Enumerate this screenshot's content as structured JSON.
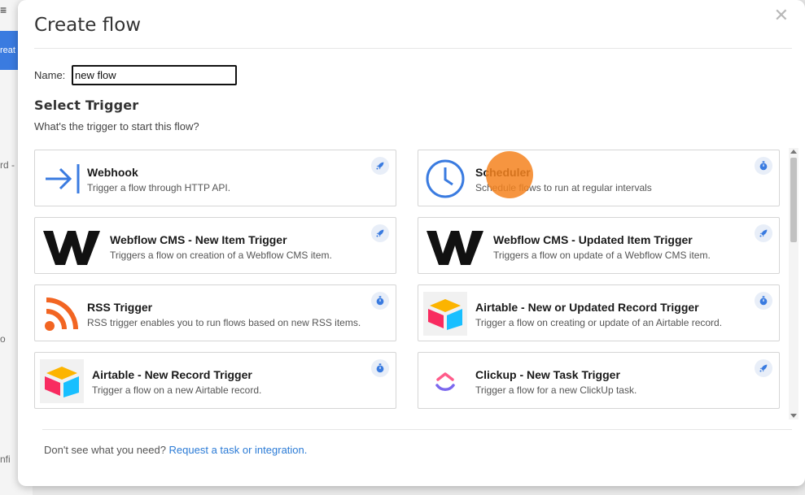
{
  "background": {
    "menu_glyph": "≡",
    "button_fragment": "reat",
    "text_fragment_1": "rd -",
    "text_fragment_2": "o",
    "text_fragment_3": "nfi"
  },
  "modal": {
    "title": "Create flow",
    "close_glyph": "✕",
    "name_label": "Name:",
    "name_value": "new flow",
    "section_title": "Select Trigger",
    "section_subtitle": "What's the trigger to start this flow?",
    "footer_text": "Don't see what you need?",
    "footer_link": "Request a task or integration."
  },
  "triggers": [
    {
      "title": "Webhook",
      "desc": "Trigger a flow through HTTP API.",
      "icon": "arrow-into-bar-icon",
      "badge": "rocket-icon"
    },
    {
      "title": "Scheduler",
      "desc": "Schedule flows to run at regular intervals",
      "icon": "clock-icon",
      "badge": "stopwatch-icon"
    },
    {
      "title": "Webflow CMS - New Item Trigger",
      "desc": "Triggers a flow on creation of a Webflow CMS item.",
      "icon": "webflow-logo-icon",
      "badge": "rocket-icon"
    },
    {
      "title": "Webflow CMS - Updated Item Trigger",
      "desc": "Triggers a flow on update of a Webflow CMS item.",
      "icon": "webflow-logo-icon",
      "badge": "rocket-icon"
    },
    {
      "title": "RSS Trigger",
      "desc": "RSS trigger enables you to run flows based on new RSS items.",
      "icon": "rss-icon",
      "badge": "stopwatch-icon"
    },
    {
      "title": "Airtable - New or Updated Record Trigger",
      "desc": "Trigger a flow on creating or update of an Airtable record.",
      "icon": "airtable-logo-icon",
      "badge": "stopwatch-icon"
    },
    {
      "title": "Airtable - New Record Trigger",
      "desc": "Trigger a flow on a new Airtable record.",
      "icon": "airtable-logo-icon",
      "badge": "stopwatch-icon"
    },
    {
      "title": "Clickup - New Task Trigger",
      "desc": "Trigger a flow for a new ClickUp task.",
      "icon": "clickup-logo-icon",
      "badge": "rocket-icon"
    }
  ],
  "colors": {
    "accent_blue": "#3a7be0",
    "link_blue": "#2b7bd6",
    "rss_orange": "#f26522",
    "cursor_highlight": "#f5821e"
  }
}
